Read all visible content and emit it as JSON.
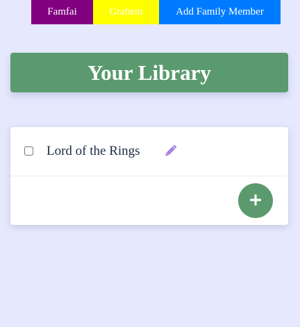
{
  "family_nav": {
    "members": [
      {
        "label": "Famfai",
        "color": "#800080"
      },
      {
        "label": "Grahem",
        "color": "#ffff00"
      }
    ],
    "add_label": "Add Family Member",
    "add_color": "#007bff"
  },
  "library": {
    "title": "Your Library",
    "accent": "#5a9a6e"
  },
  "books": [
    {
      "title": "Lord of the Rings",
      "checked": false,
      "edit_icon": "pencil-icon"
    }
  ],
  "add_book": {
    "icon": "plus-icon"
  }
}
